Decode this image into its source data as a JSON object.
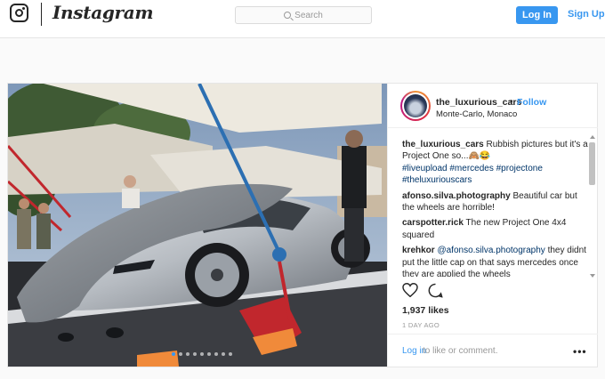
{
  "nav": {
    "brand": "Instagram",
    "search_placeholder": "Search",
    "login_button": "Log In",
    "signup_link": "Sign Up"
  },
  "post": {
    "username": "the_luxurious_cars",
    "separator": "•",
    "follow_label": "Follow",
    "location": "Monte-Carlo, Monaco",
    "carousel": {
      "count": 9,
      "active_index": 0
    },
    "caption": {
      "user": "the_luxurious_cars",
      "text": "Rubbish pictures but it's a Project One so...🙈😂",
      "hashtags": "#liveupload #mercedes #projectone #theluxuriouscars"
    },
    "comments": [
      {
        "user": "afonso.silva.photography",
        "text": "Beautiful car but the wheels are horrible!"
      },
      {
        "user": "carspotter.rick",
        "text": "The new Project One 4x4 squared"
      },
      {
        "user": "krehkor",
        "mention": "@afonso.silva.photography",
        "text": "they didnt put the little cap on that says mercedes once they are applied the wheels"
      }
    ],
    "likes": "1,937 likes",
    "timestamp": "1 DAY AGO",
    "login_prompt_link": "Log in",
    "login_prompt_rest": "to like or comment.",
    "more_label": "•••"
  },
  "icons": {
    "camera": "instagram-camera-icon",
    "search": "search-icon",
    "like": "heart-icon",
    "comment": "comment-icon",
    "more": "more-options-icon"
  },
  "colors": {
    "accent": "#3897f0",
    "hashtag": "#003569",
    "muted": "#999999"
  }
}
